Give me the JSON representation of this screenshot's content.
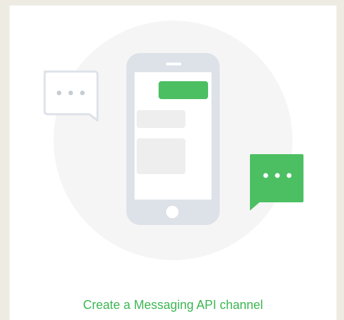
{
  "colors": {
    "page_background": "#eeebe3",
    "card_background": "#ffffff",
    "circle": "#f5f5f5",
    "phone_body": "#dde2e8",
    "phone_screen": "#ffffff",
    "message_gray": "#eeeeee",
    "accent_green": "#4cbf63",
    "link_green": "#3db654",
    "bubble_outline": "#dde2e8",
    "dots_gray": "#c5ccd4"
  },
  "illustration": {
    "phone_icon": "smartphone-icon",
    "left_bubble_icon": "chat-bubble-outline-icon",
    "right_bubble_icon": "chat-bubble-filled-icon"
  },
  "cta": {
    "label": "Create a Messaging API channel"
  }
}
